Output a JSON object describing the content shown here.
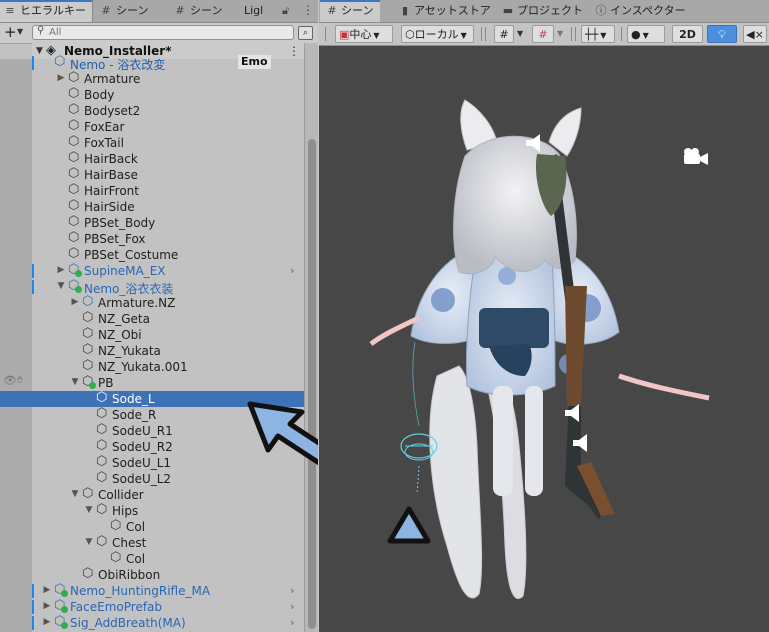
{
  "hierarchy": {
    "tabs": [
      {
        "label": "ヒエラルキー",
        "icon": "hierarchy-icon"
      },
      {
        "label": "シーン",
        "icon": "scene-grid-icon"
      },
      {
        "label": "シーン",
        "icon": "scene-grid-icon"
      },
      {
        "label": "Ligl",
        "icon": "light-icon"
      }
    ],
    "search_placeholder": "All",
    "scene_name": "Nemo_Installer*",
    "rows": [
      {
        "label": "Nemo - 浴衣改変",
        "chip": "Emo"
      },
      {
        "label": "Armature"
      },
      {
        "label": "Body"
      },
      {
        "label": "Bodyset2"
      },
      {
        "label": "FoxEar"
      },
      {
        "label": "FoxTail"
      },
      {
        "label": "HairBack"
      },
      {
        "label": "HairBase"
      },
      {
        "label": "HairFront"
      },
      {
        "label": "HairSide"
      },
      {
        "label": "PBSet_Body"
      },
      {
        "label": "PBSet_Fox"
      },
      {
        "label": "PBSet_Costume"
      },
      {
        "label": "SupineMA_EX"
      },
      {
        "label": "Nemo_浴衣衣装"
      },
      {
        "label": "Armature.NZ"
      },
      {
        "label": "NZ_Geta"
      },
      {
        "label": "NZ_Obi"
      },
      {
        "label": "NZ_Yukata"
      },
      {
        "label": "NZ_Yukata.001"
      },
      {
        "label": "PB"
      },
      {
        "label": "Sode_L"
      },
      {
        "label": "Sode_R"
      },
      {
        "label": "SodeU_R1"
      },
      {
        "label": "SodeU_R2"
      },
      {
        "label": "SodeU_L1"
      },
      {
        "label": "SodeU_L2"
      },
      {
        "label": "Collider"
      },
      {
        "label": "Hips"
      },
      {
        "label": "Col"
      },
      {
        "label": "Chest"
      },
      {
        "label": "Col"
      },
      {
        "label": "ObiRibbon"
      },
      {
        "label": "Nemo_HuntingRifle_MA"
      },
      {
        "label": "FaceEmoPrefab"
      },
      {
        "label": "Sig_AddBreath(MA)"
      }
    ],
    "selected_row": "Sode_L"
  },
  "scene_view": {
    "tabs": [
      {
        "label": "シーン",
        "icon": "scene-grid-icon"
      },
      {
        "label": "アセットストア",
        "icon": "store-bag-icon"
      },
      {
        "label": "プロジェクト",
        "icon": "folder-icon"
      },
      {
        "label": "インスペクター",
        "icon": "info-icon"
      }
    ],
    "toolbar": {
      "pivot_label": "中心",
      "space_label": "ローカル",
      "mode_2d_label": "2D"
    }
  },
  "colors": {
    "selection": "#3d73b6",
    "prefab_text": "#1f5fa8",
    "annotation_arrow_fill": "#8db4e2",
    "viewport_bg": "#474747"
  }
}
